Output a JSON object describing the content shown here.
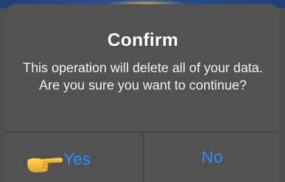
{
  "dialog": {
    "title": "Confirm",
    "message": "This operation will delete all of your data. Are you sure you want to continue?",
    "buttons": {
      "yes_label": "Yes",
      "no_label": "No"
    },
    "pointer_icon": "pointing-hand-icon"
  },
  "colors": {
    "dialog_background": "#525252",
    "button_text": "#2f8cff",
    "title_text": "#ffffff"
  }
}
